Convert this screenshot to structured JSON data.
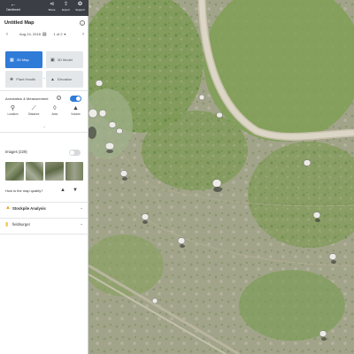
{
  "toolbar": {
    "back_label": "Dashboard",
    "share_label": "Share",
    "export_label": "Export",
    "support_label": "Support"
  },
  "map_title": "Untitled Map",
  "date_nav": {
    "date": "Aug 24, 2018",
    "pager": "1 of 2"
  },
  "view_tiles": [
    {
      "label": "2D Map",
      "icon": "map-icon",
      "active": true
    },
    {
      "label": "3D Model",
      "icon": "cube-icon",
      "active": false
    },
    {
      "label": "Plant Health",
      "icon": "leaf-icon",
      "active": false
    },
    {
      "label": "Elevation",
      "icon": "elevation-icon",
      "active": false
    }
  ],
  "annotation": {
    "label": "Annotation & Measurement",
    "enabled": true,
    "tools": [
      {
        "label": "Location",
        "icon": "pin-icon"
      },
      {
        "label": "Distance",
        "icon": "ruler-icon"
      },
      {
        "label": "Area",
        "icon": "polygon-icon"
      },
      {
        "label": "Volume",
        "icon": "volume-icon"
      }
    ]
  },
  "images": {
    "label": "Images (229)",
    "enabled": false
  },
  "quality": {
    "label": "How is the map quality?"
  },
  "sections": [
    {
      "label": "Stockpile Analysis",
      "icon": "stockpile-icon"
    },
    {
      "label": "fieldsurger",
      "icon": "folder-icon"
    }
  ],
  "colors": {
    "accent": "#2f7bd8",
    "toolbar_bg": "#3b3e44",
    "stockpile_icon": "#e8a21c",
    "folder_icon": "#f3c14b"
  }
}
